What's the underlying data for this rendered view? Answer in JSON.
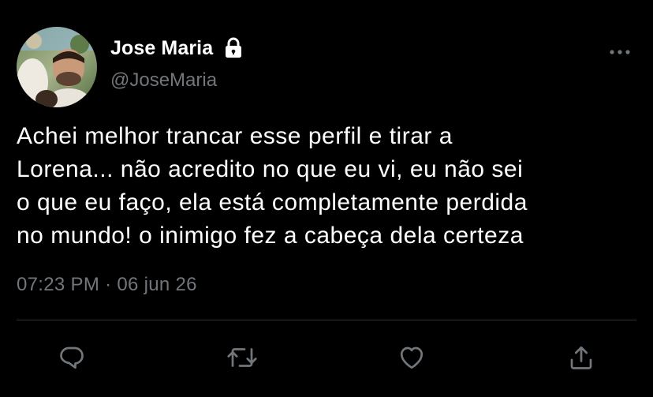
{
  "user": {
    "display_name": "Jose Maria",
    "handle": "@JoseMaria",
    "protected_icon": "lock-icon",
    "avatar": "profile-photo"
  },
  "tweet": {
    "text": "Achei melhor trancar esse perfil e tirar a\nLorena... não acredito no que eu vi, eu não sei\no que eu faço, ela está completamente perdida\nno mundo! o inimigo fez a cabeça dela certeza",
    "timestamp": "07:23 PM · 06 jun 26"
  },
  "actions": [
    {
      "name": "reply",
      "icon": "reply-icon"
    },
    {
      "name": "retweet",
      "icon": "retweet-icon"
    },
    {
      "name": "like",
      "icon": "heart-icon"
    },
    {
      "name": "share",
      "icon": "share-icon"
    }
  ],
  "menu_icon": "more-icon",
  "colors": {
    "background": "#000000",
    "text_primary": "#ffffff",
    "text_secondary": "#71767b",
    "divider": "#2f3336",
    "icon": "#71767b"
  }
}
